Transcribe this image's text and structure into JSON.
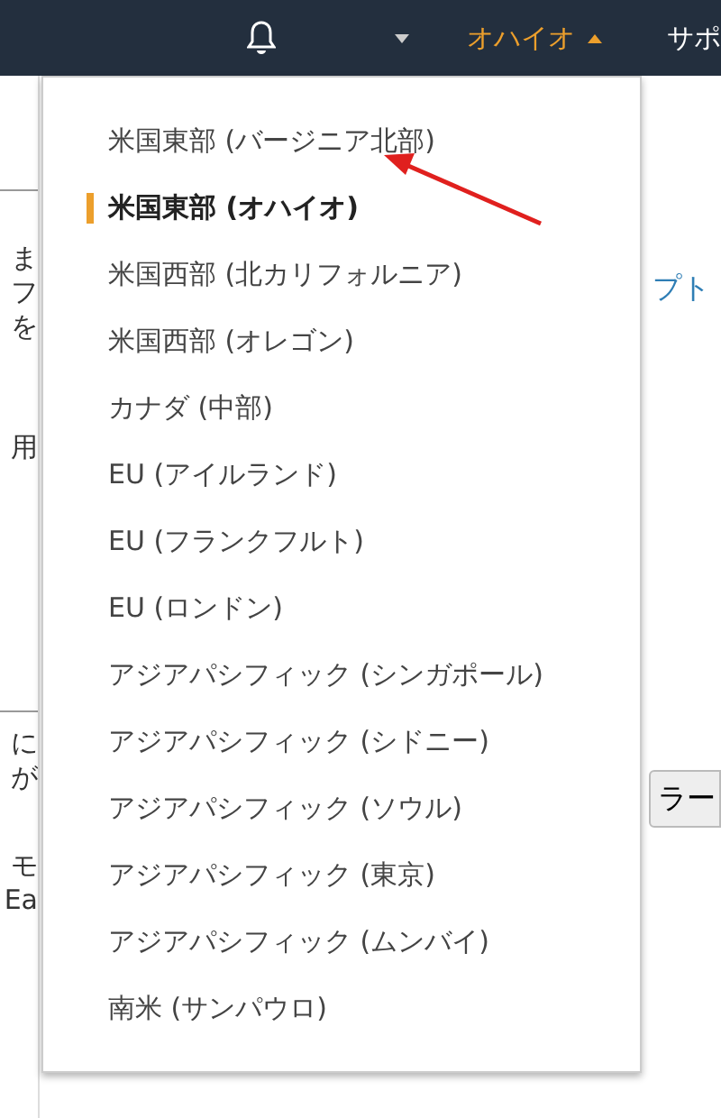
{
  "top_bar": {
    "region_menu": {
      "label": "オハイオ",
      "expanded": true
    },
    "support_menu": {
      "label": "サポ"
    }
  },
  "background": {
    "left_fragments": [
      "ま",
      "フ",
      "を",
      "用",
      "に",
      "が",
      "モ",
      "Ea"
    ],
    "link_fragment": "プト",
    "button_fragment": "ラー"
  },
  "region_dropdown": {
    "items": [
      {
        "label": "米国東部 (バージニア北部)",
        "selected": false
      },
      {
        "label": "米国東部 (オハイオ)",
        "selected": true
      },
      {
        "label": "米国西部 (北カリフォルニア)",
        "selected": false
      },
      {
        "label": "米国西部 (オレゴン)",
        "selected": false
      },
      {
        "label": "カナダ (中部)",
        "selected": false
      },
      {
        "label": "EU (アイルランド)",
        "selected": false
      },
      {
        "label": "EU (フランクフルト)",
        "selected": false
      },
      {
        "label": "EU (ロンドン)",
        "selected": false
      },
      {
        "label": "アジアパシフィック (シンガポール)",
        "selected": false
      },
      {
        "label": "アジアパシフィック (シドニー)",
        "selected": false
      },
      {
        "label": "アジアパシフィック (ソウル)",
        "selected": false
      },
      {
        "label": "アジアパシフィック (東京)",
        "selected": false
      },
      {
        "label": "アジアパシフィック (ムンバイ)",
        "selected": false
      },
      {
        "label": "南米 (サンパウロ)",
        "selected": false
      }
    ]
  }
}
